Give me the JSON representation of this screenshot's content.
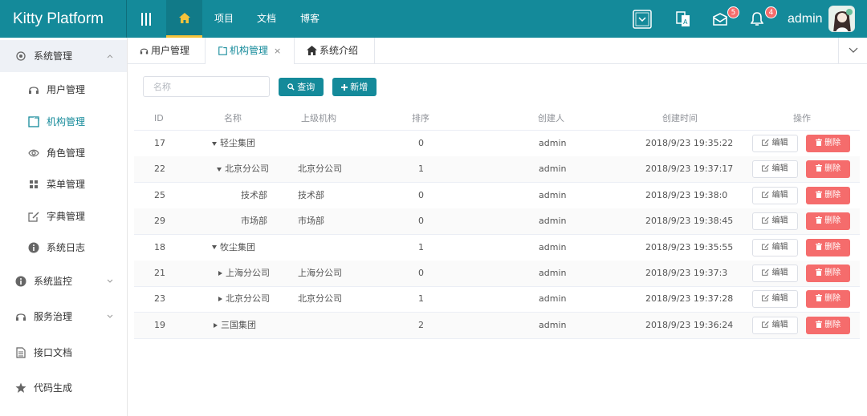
{
  "app": {
    "title": "Kitty Platform",
    "user": "admin"
  },
  "topnav": {
    "items": [
      "项目",
      "文档",
      "博客"
    ]
  },
  "badges": {
    "mail": "5",
    "bell": "4"
  },
  "sidebar": {
    "items": [
      {
        "label": "系统管理",
        "icon": "gear-icon"
      },
      {
        "label": "用户管理",
        "icon": "headset-icon"
      },
      {
        "label": "机构管理",
        "icon": "org-icon"
      },
      {
        "label": "角色管理",
        "icon": "eye-icon"
      },
      {
        "label": "菜单管理",
        "icon": "grid-icon"
      },
      {
        "label": "字典管理",
        "icon": "edit-icon"
      },
      {
        "label": "系统日志",
        "icon": "info-icon"
      },
      {
        "label": "系统监控",
        "icon": "info-icon"
      },
      {
        "label": "服务治理",
        "icon": "headset-icon"
      },
      {
        "label": "接口文档",
        "icon": "document-icon"
      },
      {
        "label": "代码生成",
        "icon": "star-icon"
      }
    ]
  },
  "tabs": [
    {
      "label": "用户管理"
    },
    {
      "label": "机构管理",
      "close": "×"
    },
    {
      "label": "系统介绍"
    }
  ],
  "toolbar": {
    "search_placeholder": "名称",
    "query_label": "查询",
    "add_label": "新增"
  },
  "table": {
    "headers": [
      "ID",
      "名称",
      "上级机构",
      "排序",
      "创建人",
      "创建时间",
      "操作"
    ],
    "edit_label": "编辑",
    "delete_label": "删除",
    "rows": [
      {
        "id": "17",
        "name": "轻尘集团",
        "parent": "",
        "order": "0",
        "creator": "admin",
        "time": "2018/9/23 19:35:22"
      },
      {
        "id": "22",
        "name": "北京分公司",
        "parent": "北京分公司",
        "order": "1",
        "creator": "admin",
        "time": "2018/9/23 19:37:17"
      },
      {
        "id": "25",
        "name": "技术部",
        "parent": "技术部",
        "order": "0",
        "creator": "admin",
        "time": "2018/9/23 19:38:0"
      },
      {
        "id": "29",
        "name": "市场部",
        "parent": "市场部",
        "order": "0",
        "creator": "admin",
        "time": "2018/9/23 19:38:45"
      },
      {
        "id": "18",
        "name": "牧尘集团",
        "parent": "",
        "order": "1",
        "creator": "admin",
        "time": "2018/9/23 19:35:55"
      },
      {
        "id": "21",
        "name": "上海分公司",
        "parent": "上海分公司",
        "order": "0",
        "creator": "admin",
        "time": "2018/9/23 19:37:3"
      },
      {
        "id": "23",
        "name": "北京分公司",
        "parent": "北京分公司",
        "order": "1",
        "creator": "admin",
        "time": "2018/9/23 19:37:28"
      },
      {
        "id": "19",
        "name": "三国集团",
        "parent": "",
        "order": "2",
        "creator": "admin",
        "time": "2018/9/23 19:36:24"
      }
    ]
  },
  "colors": {
    "primary": "#148a9a",
    "danger": "#f56c6c",
    "accent": "#f5c33b"
  }
}
